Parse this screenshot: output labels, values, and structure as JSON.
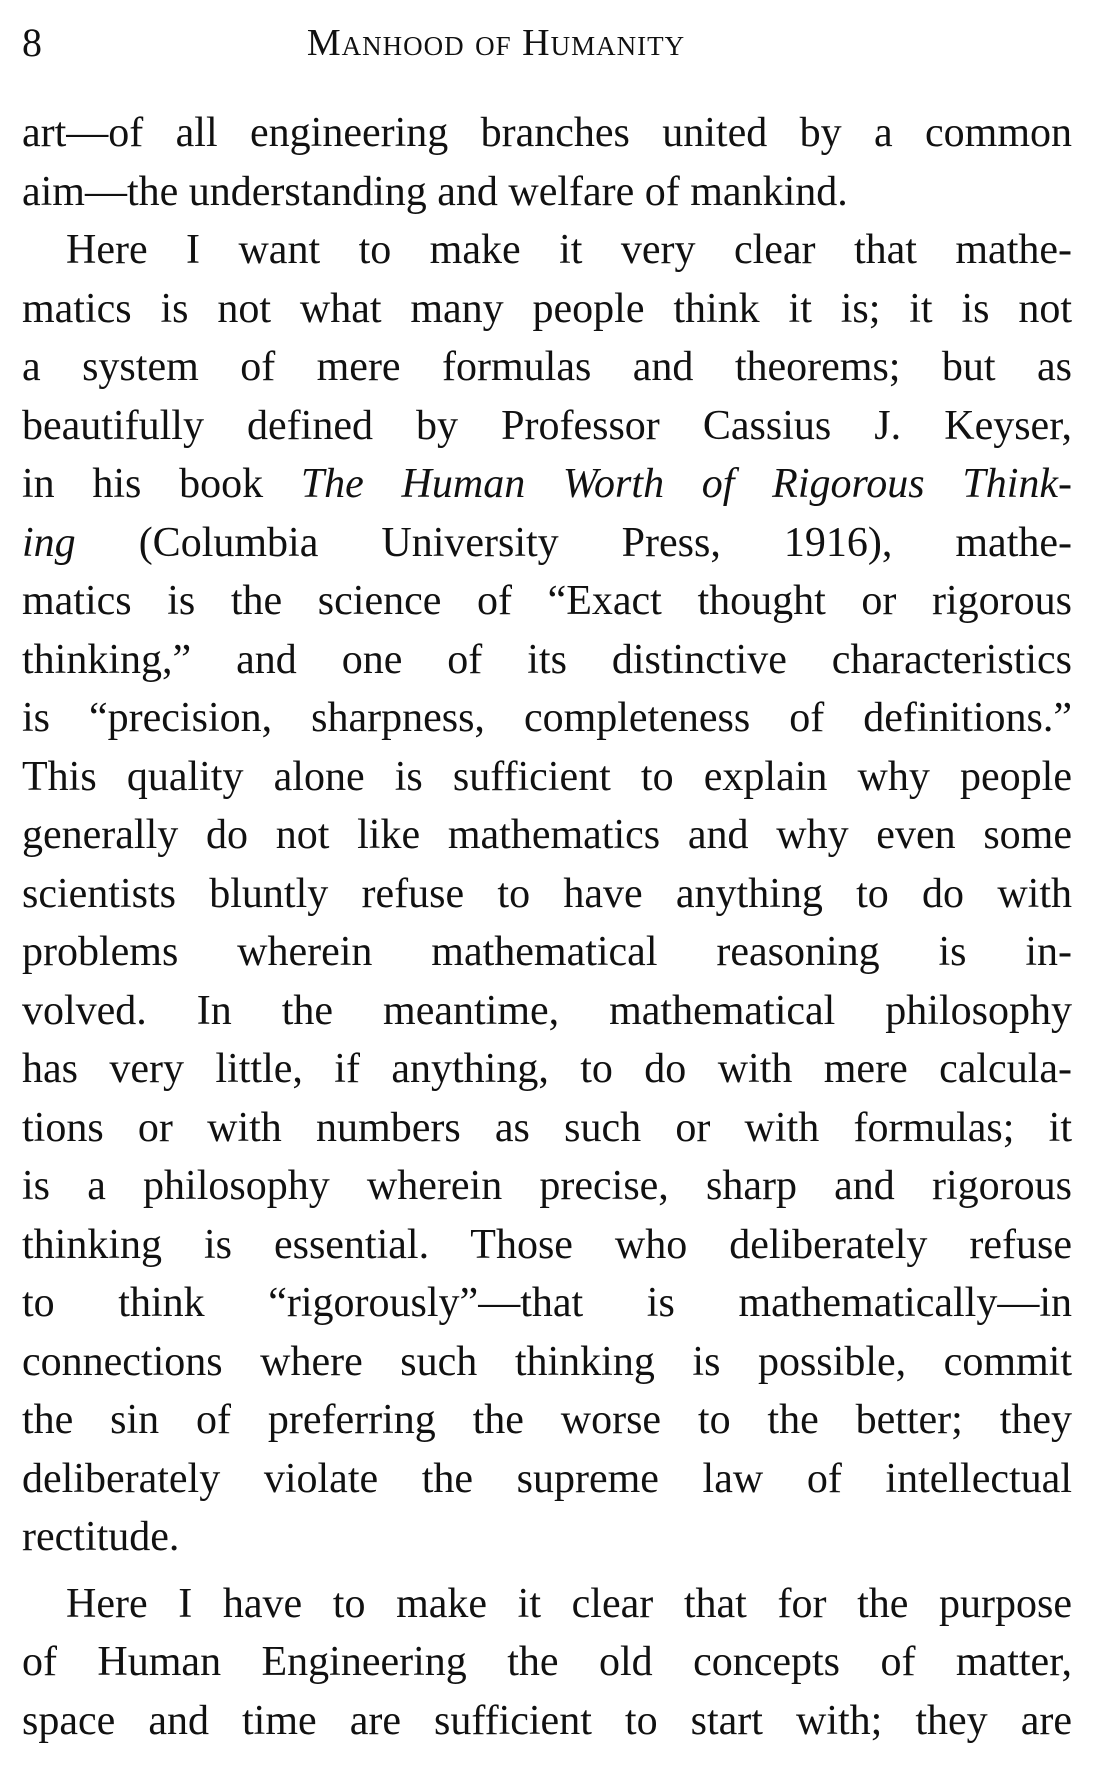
{
  "header": {
    "page_number": "8",
    "title": "Manhood of Humanity"
  },
  "body": {
    "p1": [
      "art—of all engineering branches united by a common",
      "aim—the understanding and welfare of mankind."
    ],
    "p2": {
      "l1": "Here I want to make it very clear that mathe-",
      "l2": "matics is not what many people think it is; it is not",
      "l3": "a system of mere formulas and theorems; but as",
      "l4": "beautifully defined by Professor Cassius J. Keyser,",
      "l5_pre": "in his book ",
      "l5_italic": "The Human Worth of Rigorous Think-",
      "l6_italic": "ing",
      "l6_post": " (Columbia University Press, 1916), mathe-",
      "l7": "matics is the science of “Exact thought or rigorous",
      "l8": "thinking,” and one of its distinctive characteristics",
      "l9": "is “precision, sharpness, completeness of definitions.”",
      "l10": "This quality alone is sufficient to explain why people",
      "l11": "generally do not like mathematics and why even some",
      "l12": "scientists bluntly refuse to have anything to do with",
      "l13": "problems wherein mathematical reasoning is in-",
      "l14": "volved. In the meantime, mathematical philosophy",
      "l15": "has very little, if anything, to do with mere calcula-",
      "l16": "tions or with numbers as such or with formulas; it",
      "l17": "is a philosophy wherein precise, sharp and rigorous",
      "l18": "thinking is essential. Those who deliberately refuse",
      "l19": "to think “rigorously”—that is mathematically—in",
      "l20": "connections where such thinking is possible, commit",
      "l21": "the sin of preferring the worse to the better; they",
      "l22": "deliberately violate the supreme law of intellectual",
      "l23": "rectitude."
    },
    "p3": [
      "Here I have to make it clear that for the purpose",
      "of Human Engineering the old concepts of matter,",
      "space and time are sufficient to start with; they are"
    ]
  }
}
